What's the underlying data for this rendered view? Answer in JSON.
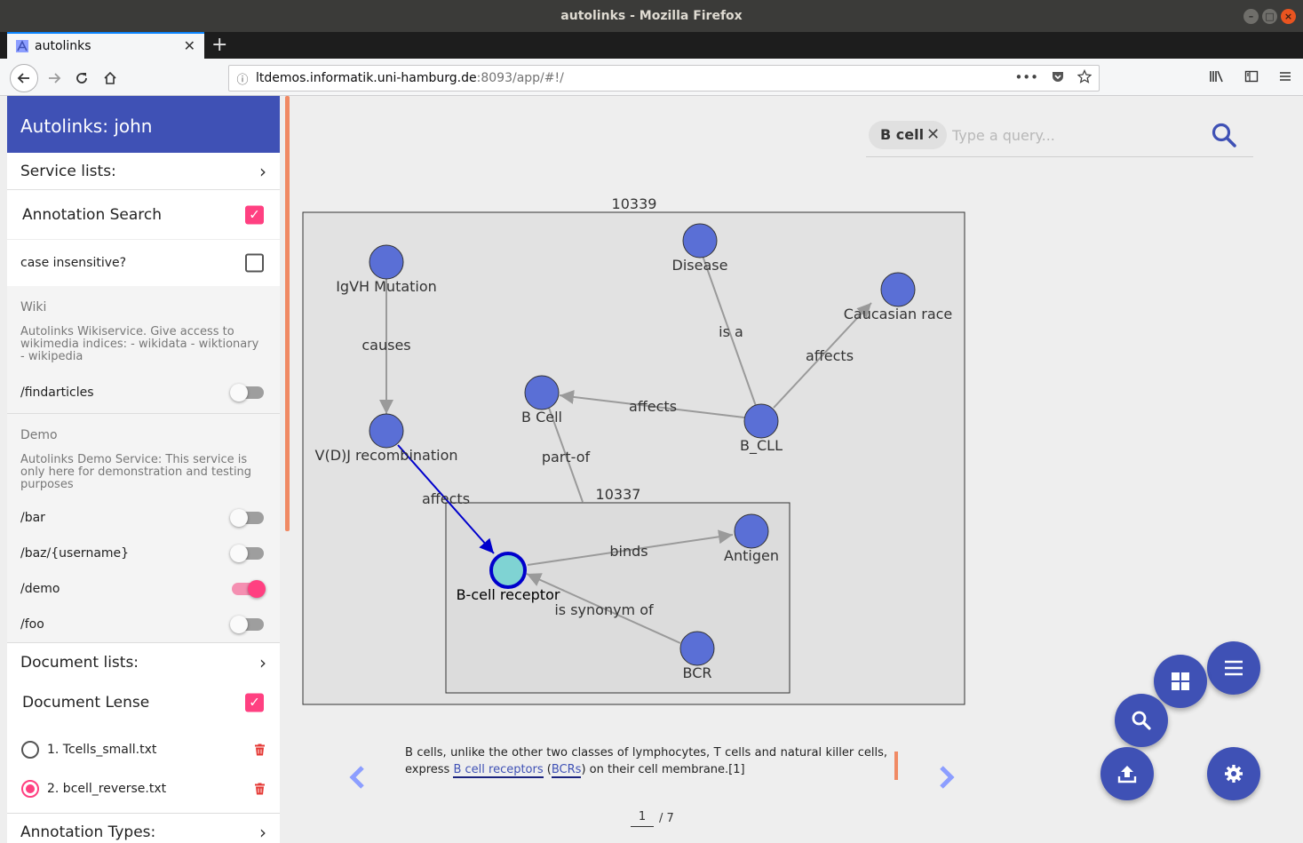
{
  "window": {
    "title": "autolinks - Mozilla Firefox"
  },
  "browser": {
    "tab_title": "autolinks",
    "url_host": "ltdemos.informatik.uni-hamburg.de",
    "url_port_path": ":8093/app/#!/",
    "url_prefix": "",
    "url_actions": "•••"
  },
  "sidebar": {
    "app_title": "Autolinks: john",
    "service_lists_label": "Service lists:",
    "annotation_search_label": "Annotation Search",
    "annotation_search_checked": true,
    "case_insensitive_label": "case insensitive?",
    "case_insensitive_checked": false,
    "groups": [
      {
        "title": "Wiki",
        "description": "Autolinks Wikiservice. Give access to wikimedia indices: - wikidata - wiktionary - wikipedia",
        "services": [
          {
            "label": "/findarticles",
            "enabled": false
          }
        ]
      },
      {
        "title": "Demo",
        "description": "Autolinks Demo Service: This service is only here for demonstration and testing purposes",
        "services": [
          {
            "label": "/bar",
            "enabled": false
          },
          {
            "label": "/baz/{username}",
            "enabled": false
          },
          {
            "label": "/demo",
            "enabled": true
          },
          {
            "label": "/foo",
            "enabled": false
          }
        ]
      }
    ],
    "document_lists_label": "Document lists:",
    "document_lense_label": "Document Lense",
    "document_lense_checked": true,
    "documents": [
      {
        "label": "1. Tcells_small.txt",
        "selected": false
      },
      {
        "label": "2. bcell_reverse.txt",
        "selected": true
      }
    ],
    "annotation_types_label": "Annotation Types:"
  },
  "search": {
    "chip_label": "B cell",
    "placeholder": "Type a query..."
  },
  "graph": {
    "outer_cluster_label": "10339",
    "inner_cluster_label": "10337",
    "nodes": [
      {
        "id": "igvh",
        "label": "IgVH Mutation"
      },
      {
        "id": "disease",
        "label": "Disease"
      },
      {
        "id": "caucasian",
        "label": "Caucasian race"
      },
      {
        "id": "bcell",
        "label": "B Cell"
      },
      {
        "id": "bcll",
        "label": "B_CLL"
      },
      {
        "id": "vdj",
        "label": "V(D)J recombination"
      },
      {
        "id": "bcr_receptor",
        "label": "B-cell receptor",
        "highlighted": true
      },
      {
        "id": "antigen",
        "label": "Antigen"
      },
      {
        "id": "bcr",
        "label": "BCR"
      }
    ],
    "edges": [
      {
        "from": "igvh",
        "to": "vdj",
        "label": "causes"
      },
      {
        "from": "bcll",
        "to": "disease",
        "label": "is a"
      },
      {
        "from": "bcll",
        "to": "caucasian",
        "label": "affects"
      },
      {
        "from": "bcll",
        "to": "bcell",
        "label": "affects"
      },
      {
        "from": "bcr_receptor",
        "to": "bcell",
        "label": "part-of"
      },
      {
        "from": "vdj",
        "to": "bcr_receptor",
        "label": "affects",
        "highlighted": true
      },
      {
        "from": "bcr_receptor",
        "to": "antigen",
        "label": "binds"
      },
      {
        "from": "bcr",
        "to": "bcr_receptor",
        "label": "is synonym of"
      }
    ],
    "colors": {
      "node": "#5a6fd6",
      "highlight_node": "#7fd3d3",
      "highlight_edge": "#0000cc",
      "edge": "#9a9a9a"
    }
  },
  "document": {
    "text_before": "B cells, unlike the other two classes of lymphocytes, T cells and natural killer cells, express ",
    "annotation_1": "B cell receptors",
    "text_middle_1": " (",
    "annotation_2": "BCRs",
    "text_after": ") on their cell membrane.[1]",
    "current_page": "1",
    "total_pages": "/ 7"
  },
  "fabs": [
    {
      "name": "menu-fab",
      "icon": "menu-icon"
    },
    {
      "name": "layout-fab",
      "icon": "grid-icon"
    },
    {
      "name": "search-fab",
      "icon": "search-icon"
    },
    {
      "name": "upload-fab",
      "icon": "upload-icon"
    },
    {
      "name": "settings-fab",
      "icon": "gear-icon"
    }
  ],
  "theme": {
    "primary": "#3f51b5",
    "accent": "#ff4081",
    "scroll_accent": "#f08a64"
  }
}
